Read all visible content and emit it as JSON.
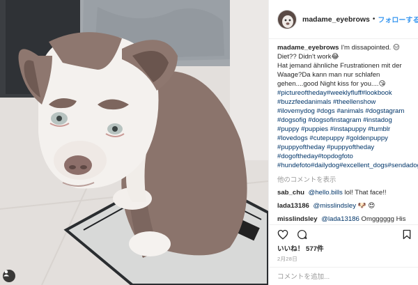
{
  "post": {
    "username": "madame_eyebrows",
    "follow_label": "フォローする",
    "separator": "•"
  },
  "caption": {
    "username": "madame_eyebrows",
    "lines": [
      "I'm dissapointed. 😑",
      "Diet?? Didn't work😂",
      "Hat jemand ähnliche Frustrationen mit der Waage?Da kann man nur schlafen gehen....good Night kiss for you....😘"
    ],
    "hashtags": "#pictureoftheday#weeklyfluff#lookbook #buzzfeedanimals #theellenshow #ilovemydog #dogs #animals #dogstagram #dogsofig #dogsofinstagram #instadog #puppy #puppies #instapuppy #tumblr #lovedogs #cutepuppy #goldenpuppy #puppyoftheday #puppyoftheday #dogoftheday#topdogfoto #hundefoto#dailydog#excellent_dogs#sendadogphoto#doglove#diet#figur"
  },
  "view_all_comments": "他のコメントを表示",
  "comments": [
    {
      "username": "sab_chu",
      "mention": "@hello.bills",
      "text": " lol! That face!!"
    },
    {
      "username": "lada13186",
      "mention": "@misslindsley",
      "text": " 🐶 😍"
    },
    {
      "username": "misslindsley",
      "mention": "@lada13186",
      "text": " Omgggggg His name needs to be Eugene!"
    }
  ],
  "likes": "いいね！ 577件",
  "date": "2月28日",
  "add_comment_placeholder": "コメントを追加...",
  "icons": {
    "like": "heart-icon",
    "comment": "comment-icon",
    "save": "bookmark-icon",
    "tag": "user-tag-icon"
  }
}
